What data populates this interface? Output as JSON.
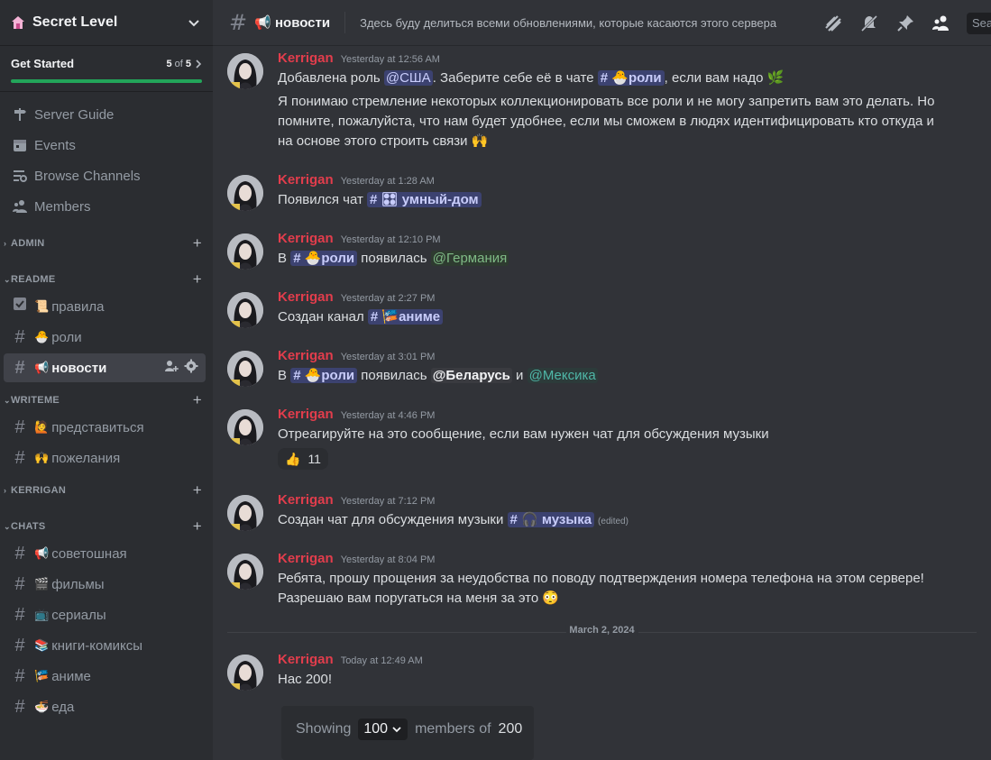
{
  "server": {
    "name": "Secret Level"
  },
  "get_started": {
    "title": "Get Started",
    "done": "5",
    "of": "of",
    "total": "5",
    "progress": 1.0
  },
  "nav": [
    {
      "label": "Server Guide",
      "icon": "signpost-icon"
    },
    {
      "label": "Events",
      "icon": "calendar-icon"
    },
    {
      "label": "Browse Channels",
      "icon": "browse-icon"
    },
    {
      "label": "Members",
      "icon": "members-icon"
    }
  ],
  "categories": {
    "admin": "ADMIN",
    "readme": "README",
    "writeme": "WRITEME",
    "kerrigan": "KERRIGAN",
    "chats": "CHATS"
  },
  "channels": {
    "rules": {
      "emoji": "📜",
      "name": "правила"
    },
    "roles": {
      "emoji": "🐣",
      "name": "роли"
    },
    "news": {
      "emoji": "📢",
      "name": "новости"
    },
    "intro": {
      "emoji": "🙋",
      "name": "представиться"
    },
    "wishes": {
      "emoji": "🙌",
      "name": "пожелания"
    },
    "advice": {
      "emoji": "📢",
      "name": "советошная"
    },
    "films": {
      "emoji": "🎬",
      "name": "фильмы"
    },
    "series": {
      "emoji": "📺",
      "name": "сериалы"
    },
    "books": {
      "emoji": "📚",
      "name": "книги-комиксы"
    },
    "anime": {
      "emoji": "🎏",
      "name": "аниме"
    },
    "food": {
      "emoji": "🍜",
      "name": "еда"
    }
  },
  "topbar": {
    "channel_emoji": "📢",
    "channel_name": "новости",
    "topic": "Здесь буду делиться всеми обновлениями, которые касаются этого сервера",
    "search_placeholder": "Sea"
  },
  "messages": [
    {
      "author": "Kerrigan",
      "time": "Yesterday at 12:56 AM",
      "p1": "Добавлена роль ",
      "role": "@США",
      "p2": ". Заберите себе её в чате ",
      "ch": "# 🐣роли",
      "p3": ", если вам надо 🌿",
      "body2": "Я понимаю стремление некоторых коллекционировать все роли и не могу запретить вам это делать. Но",
      "body3": "помните, пожалуйста, что нам будет удобнее, если мы сможем в людях идентифицировать кто откуда и",
      "body4": "на основе этого строить связи 🙌"
    },
    {
      "author": "Kerrigan",
      "time": "Yesterday at 1:28 AM",
      "p1": "Появился чат ",
      "ch": "# 🎛 умный-дом"
    },
    {
      "author": "Kerrigan",
      "time": "Yesterday at 12:10 PM",
      "p1": "В ",
      "ch": "# 🐣роли",
      "p2": " появилась ",
      "role": "@Германия"
    },
    {
      "author": "Kerrigan",
      "time": "Yesterday at 2:27 PM",
      "p1": "Создан канал ",
      "ch": "# 🎏аниме"
    },
    {
      "author": "Kerrigan",
      "time": "Yesterday at 3:01 PM",
      "p1": "В ",
      "ch": "# 🐣роли",
      "p2": " появилась ",
      "role": "@Беларусь",
      "p3": " и ",
      "role2": "@Мексика"
    },
    {
      "author": "Kerrigan",
      "time": "Yesterday at 4:46 PM",
      "p1": "Отреагируйте на это сообщение, если вам нужен чат для обсуждения музыки",
      "reaction_emoji": "👍",
      "reaction_count": "11"
    },
    {
      "author": "Kerrigan",
      "time": "Yesterday at 7:12 PM",
      "p1": "Создан чат для обсуждения музыки ",
      "ch": "# 🎧 музыка",
      "edited": "(edited)"
    },
    {
      "author": "Kerrigan",
      "time": "Yesterday at 8:04 PM",
      "p1": "Ребята, прошу прощения за неудобства по поводу подтверждения номера телефона на этом сервере!",
      "body2": "Разрешаю вам поругаться на меня за это 😳"
    },
    {
      "author": "Kerrigan",
      "time": "Today at 12:49 AM",
      "p1": "Нас 200!"
    }
  ],
  "date_separator": "March 2, 2024",
  "embed": {
    "showing": "Showing",
    "count": "100",
    "members_of": "members of",
    "total": "200"
  },
  "colors": {
    "accent": "#5865f2",
    "author": "#e23d4c",
    "progress": "#23a55a"
  }
}
